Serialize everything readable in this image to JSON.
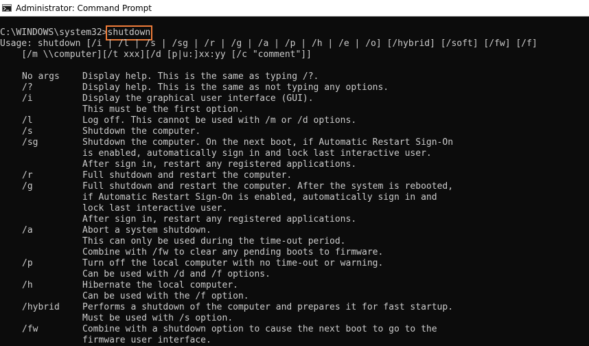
{
  "window": {
    "title": "Administrator: Command Prompt",
    "icon": "cmd-icon"
  },
  "prompt": {
    "path": "C:\\WINDOWS\\system32>",
    "command": "shutdown",
    "highlight_color": "#f07d3a"
  },
  "usage": {
    "line1": "Usage: shutdown [/i | /l | /s | /sg | /r | /g | /a | /p | /h | /e | /o] [/hybrid] [/soft] [/fw] [/f]",
    "line2": "    [/m \\\\computer][/t xxx][/d [p|u:]xx:yy [/c \"comment\"]]"
  },
  "options": [
    {
      "flag": "No args",
      "lines": [
        "Display help. This is the same as typing /?."
      ]
    },
    {
      "flag": "/?",
      "lines": [
        "Display help. This is the same as not typing any options."
      ]
    },
    {
      "flag": "/i",
      "lines": [
        "Display the graphical user interface (GUI).",
        "This must be the first option."
      ]
    },
    {
      "flag": "/l",
      "lines": [
        "Log off. This cannot be used with /m or /d options."
      ]
    },
    {
      "flag": "/s",
      "lines": [
        "Shutdown the computer."
      ]
    },
    {
      "flag": "/sg",
      "lines": [
        "Shutdown the computer. On the next boot, if Automatic Restart Sign-On",
        "is enabled, automatically sign in and lock last interactive user.",
        "After sign in, restart any registered applications."
      ]
    },
    {
      "flag": "/r",
      "lines": [
        "Full shutdown and restart the computer."
      ]
    },
    {
      "flag": "/g",
      "lines": [
        "Full shutdown and restart the computer. After the system is rebooted,",
        "if Automatic Restart Sign-On is enabled, automatically sign in and",
        "lock last interactive user.",
        "After sign in, restart any registered applications."
      ]
    },
    {
      "flag": "/a",
      "lines": [
        "Abort a system shutdown.",
        "This can only be used during the time-out period.",
        "Combine with /fw to clear any pending boots to firmware."
      ]
    },
    {
      "flag": "/p",
      "lines": [
        "Turn off the local computer with no time-out or warning.",
        "Can be used with /d and /f options."
      ]
    },
    {
      "flag": "/h",
      "lines": [
        "Hibernate the local computer.",
        "Can be used with the /f option."
      ]
    },
    {
      "flag": "/hybrid",
      "lines": [
        "Performs a shutdown of the computer and prepares it for fast startup.",
        "Must be used with /s option."
      ]
    },
    {
      "flag": "/fw",
      "lines": [
        "Combine with a shutdown option to cause the next boot to go to the",
        "firmware user interface."
      ]
    }
  ]
}
